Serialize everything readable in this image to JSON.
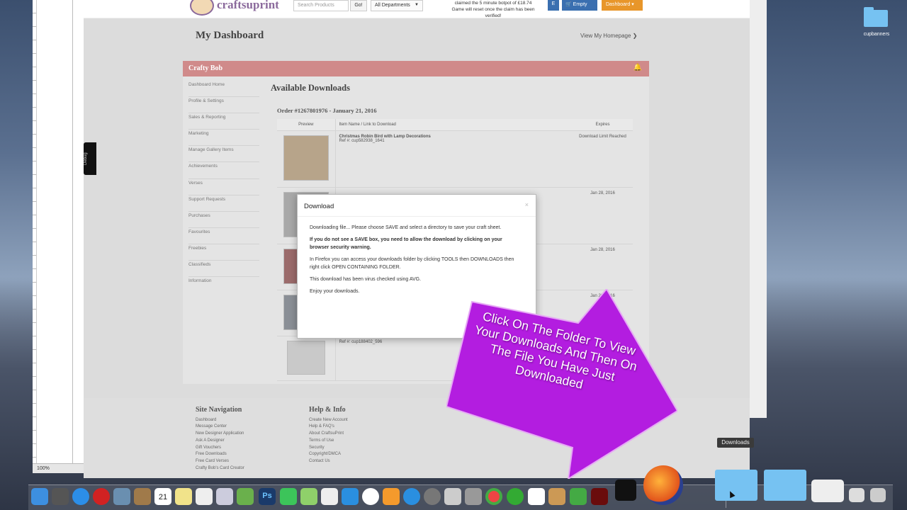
{
  "header": {
    "logo_text": "craftsuprint",
    "search_placeholder": "Search Products",
    "go_label": "Go!",
    "department": "All Departments",
    "promo_line1": "claimed the 5 minute botpot of £18.74",
    "promo_line2": "Game will reset once the claim has been verified!",
    "e_label": "E",
    "cart_label": "Empty",
    "dashboard_label": "Dashboard"
  },
  "dashboard": {
    "title": "My Dashboard",
    "homepage_link": "View My Homepage"
  },
  "user": {
    "name": "Crafty Bob"
  },
  "sidebar": {
    "items": [
      {
        "label": "Dashboard Home"
      },
      {
        "label": "Profile & Settings"
      },
      {
        "label": "Sales & Reporting"
      },
      {
        "label": "Marketing"
      },
      {
        "label": "Manage Gallery Items"
      },
      {
        "label": "Achievements"
      },
      {
        "label": "Verses"
      },
      {
        "label": "Support Requests"
      },
      {
        "label": "Purchases"
      },
      {
        "label": "Favourites"
      },
      {
        "label": "Freebies"
      },
      {
        "label": "Classifieds"
      },
      {
        "label": "Information"
      }
    ]
  },
  "downloads": {
    "heading": "Available Downloads",
    "order": "Order #1267801976 - January 21, 2016",
    "columns": {
      "preview": "Preview",
      "item": "Item Name / Link to Download",
      "expires": "Expires"
    },
    "rows": [
      {
        "name": "Christmas Robin Bird with Lamp Decorations",
        "ref": "Ref #: cup582938_1641",
        "expires": "Download Limit Reached"
      },
      {
        "name": "",
        "ref": "",
        "expires": "Jan 28, 2016"
      },
      {
        "name": "",
        "ref": "",
        "expires": "Jan 28, 2016"
      },
      {
        "name": "",
        "ref": "",
        "expires": "Jan 28, 2016"
      },
      {
        "name": "",
        "ref": "Ref #: cup188402_596",
        "expires": ""
      }
    ]
  },
  "footer": {
    "nav_heading": "Site Navigation",
    "nav_links": [
      "Dashboard",
      "Message Center",
      "New Designer Application",
      "Ask A Designer",
      "Gift Vouchers",
      "Free Downloads",
      "Free Card Verses",
      "Crafty Bob's Card Creator"
    ],
    "help_heading": "Help & Info",
    "help_links": [
      "Create New Account",
      "Help & FAQ's",
      "About CraftsuPrint",
      "Terms of Use",
      "Security",
      "Copyright/DMCA",
      "Contact Us"
    ]
  },
  "dialog": {
    "title": "Download",
    "close": "×",
    "p1": "Downloading file... Please choose SAVE and select a directory to save your craft sheet.",
    "p2": "If you do not see a SAVE box, you need to allow the download by clicking on your browser security warning.",
    "p3": "In Firefox you can access your downloads folder by clicking TOOLS then DOWNLOADS then right click OPEN CONTAINING FOLDER.",
    "p4": "This download has been virus checked using AVG.",
    "p5": "Enjoy your downloads."
  },
  "callout": {
    "text": "Click On The Folder To View Your Downloads And Then On The File You Have Just Downloaded"
  },
  "desktop": {
    "folder_label": "cupbanners",
    "tooltip": "Downloads"
  },
  "left_window": {
    "zoom": "100%"
  },
  "debug_tab": "Debug",
  "dock": {
    "calendar_day": "21"
  },
  "colors": {
    "header_bar": "#d08a8a",
    "callout_purple": "#b31de0",
    "cart_blue": "#3a6fb0",
    "dashboard_orange": "#e8962a"
  }
}
